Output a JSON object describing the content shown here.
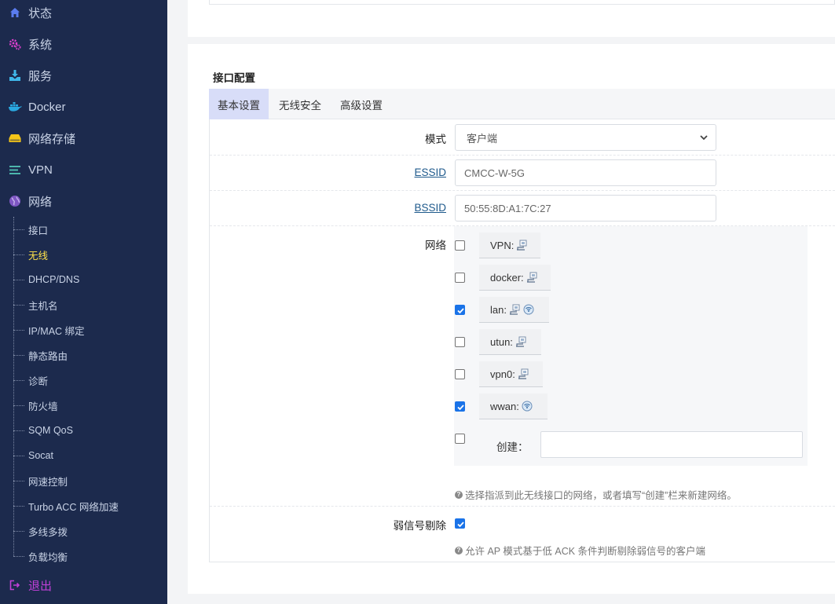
{
  "sidebar": {
    "menu": [
      {
        "label": "状态",
        "icon": "home-icon",
        "color": "#5a7cf0"
      },
      {
        "label": "系统",
        "icon": "gear-icon",
        "color": "#e040d0"
      },
      {
        "label": "服务",
        "icon": "download-icon",
        "color": "#3fb7ea"
      },
      {
        "label": "Docker",
        "icon": "docker-icon",
        "color": "#2aa8e0"
      },
      {
        "label": "网络存储",
        "icon": "storage-icon",
        "color": "#f5c518"
      },
      {
        "label": "VPN",
        "icon": "list-icon",
        "color": "#4db6ac"
      },
      {
        "label": "网络",
        "icon": "globe-icon",
        "color": "#7e57c2"
      }
    ],
    "submenu": [
      {
        "label": "接口"
      },
      {
        "label": "无线",
        "active": true
      },
      {
        "label": "DHCP/DNS"
      },
      {
        "label": "主机名"
      },
      {
        "label": "IP/MAC 绑定"
      },
      {
        "label": "静态路由"
      },
      {
        "label": "诊断"
      },
      {
        "label": "防火墙"
      },
      {
        "label": "SQM QoS"
      },
      {
        "label": "Socat"
      },
      {
        "label": "网速控制"
      },
      {
        "label": "Turbo ACC 网络加速"
      },
      {
        "label": "多线多拨"
      },
      {
        "label": "负载均衡"
      }
    ],
    "logout": {
      "label": "退出",
      "icon": "logout-icon",
      "color": "#c040d8"
    },
    "accent_active": "#ffe24a"
  },
  "section": {
    "title": "接口配置"
  },
  "tabs": [
    {
      "label": "基本设置",
      "active": true
    },
    {
      "label": "无线安全"
    },
    {
      "label": "高级设置"
    }
  ],
  "form": {
    "mode": {
      "label": "模式",
      "value": "客户端"
    },
    "essid": {
      "label": "ESSID",
      "value": "CMCC-W-5G"
    },
    "bssid": {
      "label": "BSSID",
      "value": "50:55:8D:A1:7C:27"
    },
    "network": {
      "label": "网络",
      "items": [
        {
          "name": "VPN:",
          "checked": false,
          "icons": [
            "ethernet-icon"
          ]
        },
        {
          "name": "docker:",
          "checked": false,
          "icons": [
            "ethernet-icon"
          ]
        },
        {
          "name": "lan:",
          "checked": true,
          "icons": [
            "ethernet-icon",
            "wifi-icon"
          ]
        },
        {
          "name": "utun:",
          "checked": false,
          "icons": [
            "ethernet-icon"
          ]
        },
        {
          "name": "vpn0:",
          "checked": false,
          "icons": [
            "ethernet-icon"
          ]
        },
        {
          "name": "wwan:",
          "checked": true,
          "icons": [
            "wifi-icon"
          ]
        }
      ],
      "create": {
        "label": "创建：",
        "checked": false,
        "value": ""
      },
      "hint": "选择指派到此无线接口的网络，或者填写“创建”栏来新建网络。"
    },
    "weak_signal": {
      "label": "弱信号剔除",
      "checked": true,
      "hint": "允许 AP 模式基于低 ACK 条件判断剔除弱信号的客户端"
    }
  }
}
